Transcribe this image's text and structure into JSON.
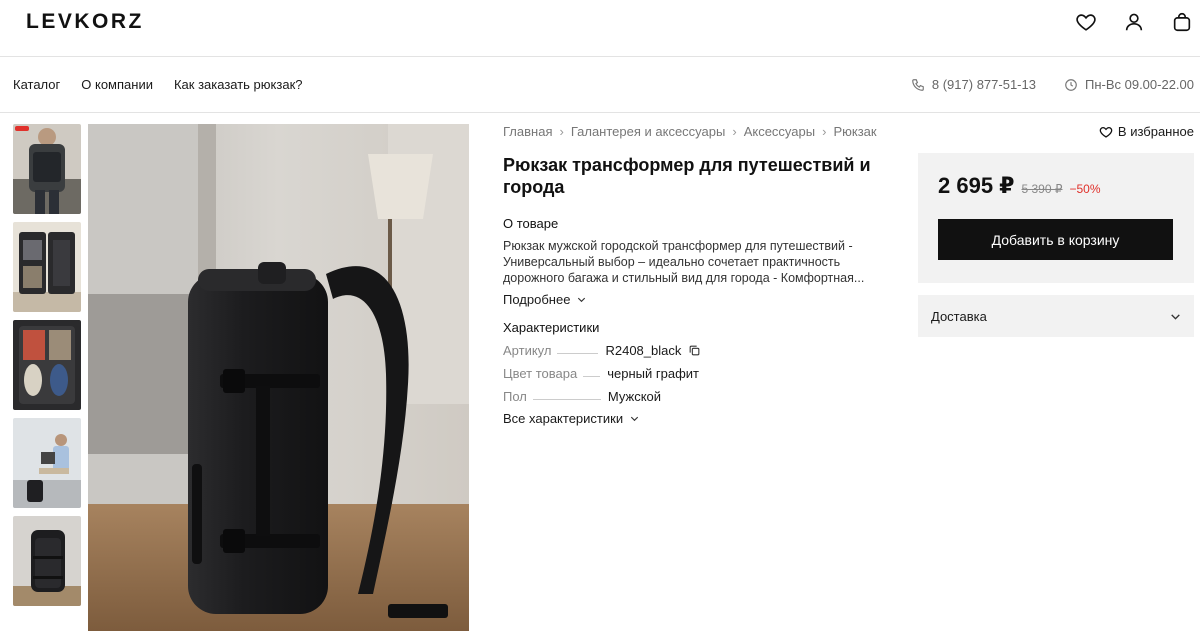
{
  "header": {
    "logo": "LEVKORZ",
    "icons": [
      "heart-icon",
      "user-icon",
      "bag-icon"
    ]
  },
  "nav": {
    "links": [
      "Каталог",
      "О компании",
      "Как заказать рюкзак?"
    ],
    "phone": "8 (917) 877-51-13",
    "hours": "Пн-Вс 09.00-22.00"
  },
  "gallery": {
    "thumbnails": [
      "thumb-1",
      "thumb-2",
      "thumb-3",
      "thumb-4",
      "thumb-5"
    ]
  },
  "breadcrumbs": [
    "Главная",
    "Галантерея и аксессуары",
    "Аксессуары",
    "Рюкзак"
  ],
  "product": {
    "title": "Рюкзак трансформер для путешествий и города",
    "about_heading": "О товаре",
    "about_text": "Рюкзак мужской городской трансформер для путешествий - Универсальный выбор – идеально сочетает практичность дорожного багажа и стильный вид для города - Комфортная...",
    "more_label": "Подробнее",
    "specs_heading": "Характеристики",
    "specs": [
      {
        "key": "Артикул",
        "value": "R2408_black"
      },
      {
        "key": "Цвет товара",
        "value": "черный графит"
      },
      {
        "key": "Пол",
        "value": "Мужской"
      }
    ],
    "all_specs_label": "Все характеристики"
  },
  "purchase": {
    "favorite_label": "В избранное",
    "price": "2 695 ₽",
    "old_price": "5 390 ₽",
    "discount": "−50%",
    "add_to_cart": "Добавить в корзину",
    "delivery_label": "Доставка",
    "discount_color": "#e0312b",
    "button_color": "#111111"
  }
}
